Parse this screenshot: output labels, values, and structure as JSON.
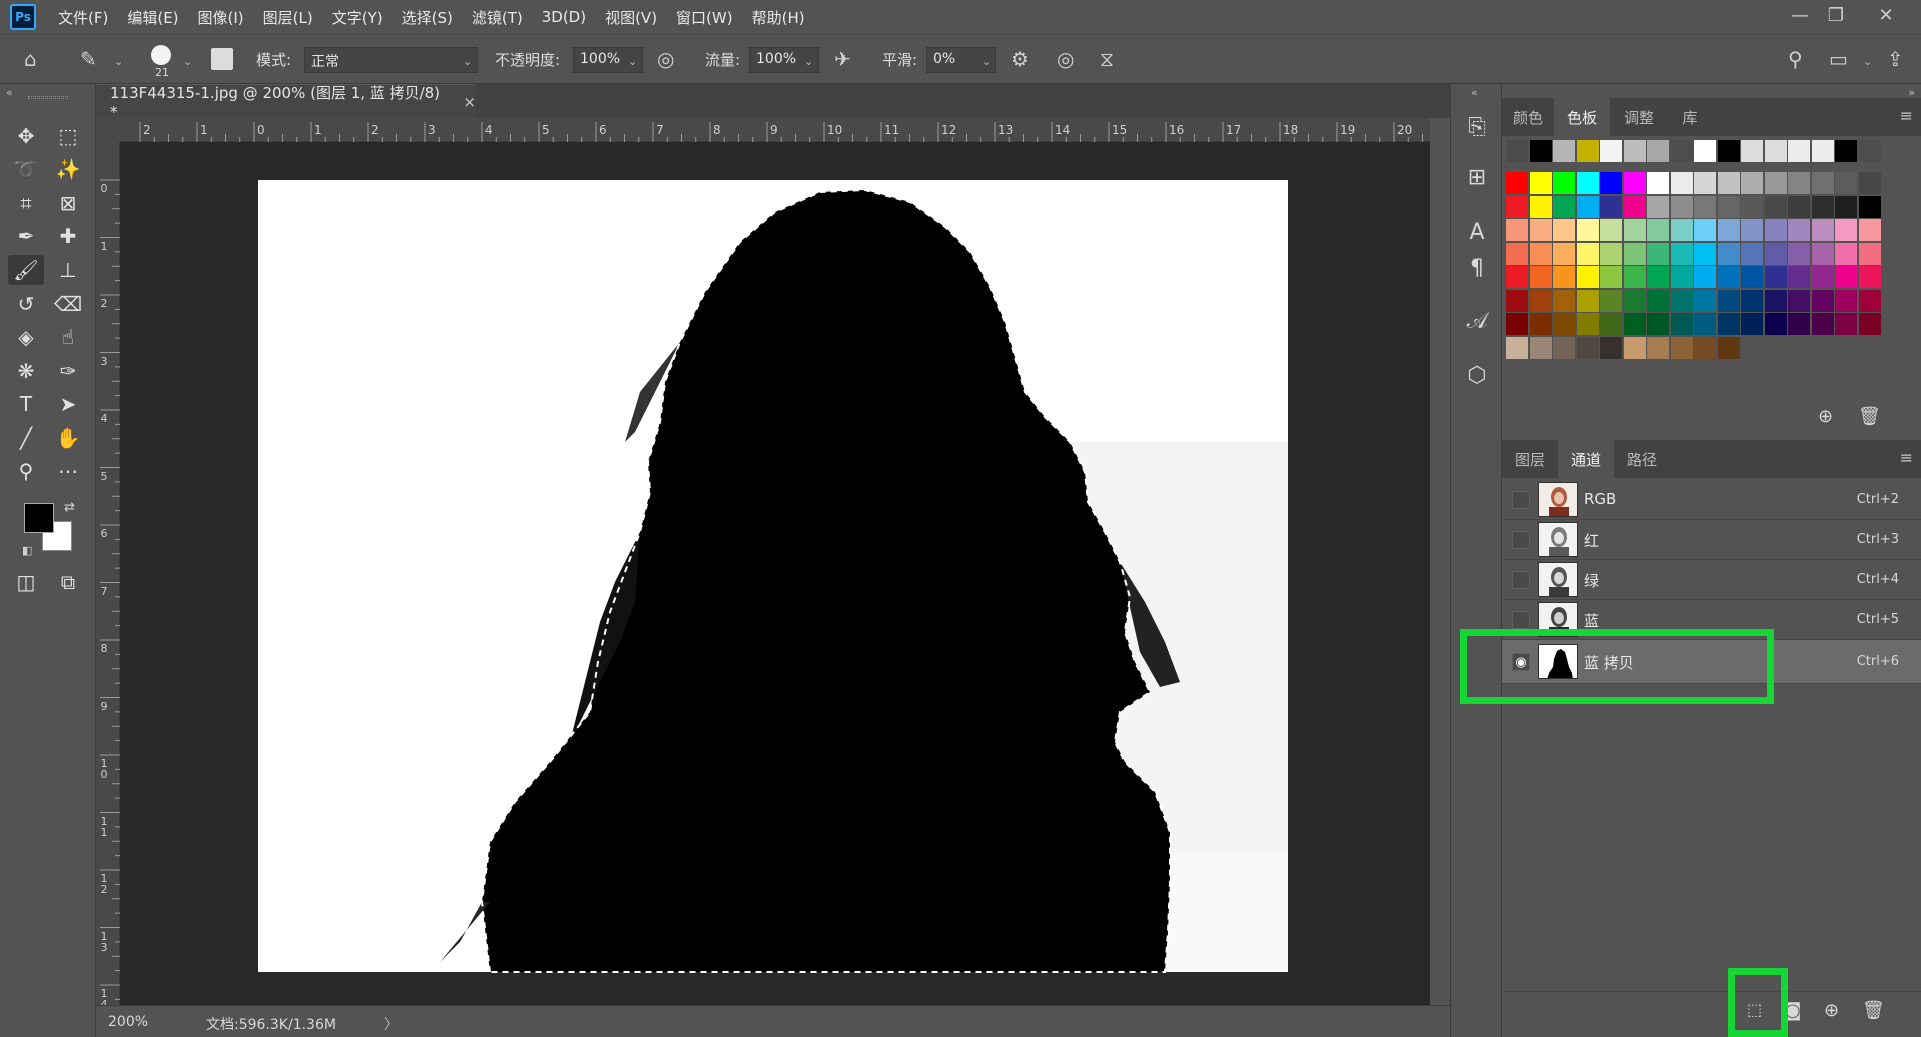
{
  "app": {
    "logo": "Ps"
  },
  "menu": [
    "文件(F)",
    "编辑(E)",
    "图像(I)",
    "图层(L)",
    "文字(Y)",
    "选择(S)",
    "滤镜(T)",
    "3D(D)",
    "视图(V)",
    "窗口(W)",
    "帮助(H)"
  ],
  "options": {
    "brush_size": "21",
    "mode_label": "模式:",
    "mode_value": "正常",
    "opacity_label": "不透明度:",
    "opacity_value": "100%",
    "flow_label": "流量:",
    "flow_value": "100%",
    "smooth_label": "平滑:",
    "smooth_value": "0%"
  },
  "document": {
    "tab_title": "113F44315-1.jpg @ 200% (图层 1, 蓝 拷贝/8) *",
    "close_glyph": "×"
  },
  "ruler": {
    "h_ticks": [
      "2",
      "1",
      "0",
      "1",
      "2",
      "3",
      "4",
      "5",
      "6",
      "7",
      "8",
      "9",
      "10",
      "11",
      "12",
      "13",
      "14",
      "15",
      "16",
      "17",
      "18",
      "19",
      "20"
    ],
    "v_ticks": [
      "0",
      "1",
      "2",
      "3",
      "4",
      "5",
      "6",
      "7",
      "8",
      "9",
      "10",
      "11",
      "12",
      "13",
      "14"
    ]
  },
  "status": {
    "zoom": "200%",
    "doc_info": "文档:596.3K/1.36M"
  },
  "swatch_panel": {
    "tabs": [
      "颜色",
      "色板",
      "调整",
      "库"
    ],
    "active_tab": "色板"
  },
  "channels_panel": {
    "tabs": [
      "图层",
      "通道",
      "路径"
    ],
    "active_tab": "通道",
    "channels": [
      {
        "name": "RGB",
        "shortcut": "Ctrl+2",
        "visible": false,
        "thumb": "color"
      },
      {
        "name": "红",
        "shortcut": "Ctrl+3",
        "visible": false,
        "thumb": "gray"
      },
      {
        "name": "绿",
        "shortcut": "Ctrl+4",
        "visible": false,
        "thumb": "gray"
      },
      {
        "name": "蓝",
        "shortcut": "Ctrl+5",
        "visible": false,
        "thumb": "gray"
      },
      {
        "name": "蓝 拷贝",
        "shortcut": "Ctrl+6",
        "visible": true,
        "thumb": "mask",
        "selected": true
      }
    ]
  },
  "colors": {
    "highlight": "#16d636",
    "swatch_rows": [
      [
        "#4b4b4b",
        "#000000",
        "#b5b5b5",
        "#c4b000",
        "#f4f4f4",
        "#bdbdbd",
        "#a8a8a8",
        "#4d4d4d",
        "#ffffff",
        "#000000",
        "#dcdcdc",
        "#dcdcdc",
        "#ececec",
        "#ececec",
        "#000000",
        "#4d4d4d"
      ],
      [
        "#ff0000",
        "#ffff00",
        "#00ff00",
        "#00ffff",
        "#0000ff",
        "#ff00ff",
        "#ffffff",
        "#ebebeb",
        "#d6d6d6",
        "#c2c2c2",
        "#adadad",
        "#999999",
        "#858585",
        "#707070",
        "#5c5c5c",
        "#474747"
      ],
      [
        "#ed1c24",
        "#fff200",
        "#00a651",
        "#00aeef",
        "#2e3192",
        "#ec008c",
        "#a6a6a6",
        "#8c8c8c",
        "#787878",
        "#666666",
        "#595959",
        "#4a4a4a",
        "#3d3d3d",
        "#2e2e2e",
        "#1f1f1f",
        "#000000"
      ],
      [
        "#f7977a",
        "#f9ad81",
        "#fdc68a",
        "#fff79a",
        "#c4df9b",
        "#a3d39c",
        "#82ca9d",
        "#7bcdc8",
        "#6ecff6",
        "#7ea7d8",
        "#8493ca",
        "#8882be",
        "#a187be",
        "#bc8dbf",
        "#f49ac2",
        "#f6989d"
      ],
      [
        "#f26c4f",
        "#f68e55",
        "#fbaf5c",
        "#fff467",
        "#acd372",
        "#7cc576",
        "#3bb878",
        "#1abbb4",
        "#00bff3",
        "#438ccb",
        "#5574b9",
        "#605ca8",
        "#855fa8",
        "#a763a8",
        "#f06ea9",
        "#f26d7d"
      ],
      [
        "#ed1c24",
        "#f26522",
        "#f7941d",
        "#fff200",
        "#8dc63f",
        "#39b54a",
        "#00a651",
        "#00a99d",
        "#00aeef",
        "#0072bc",
        "#0054a6",
        "#2e3192",
        "#662d91",
        "#92278f",
        "#ec008c",
        "#ed145b"
      ],
      [
        "#9e0b0f",
        "#a0410d",
        "#a36209",
        "#aba000",
        "#598527",
        "#1a7b30",
        "#007236",
        "#00746b",
        "#0076a3",
        "#004a80",
        "#003471",
        "#1b1464",
        "#440e62",
        "#630460",
        "#9e005d",
        "#9e0039"
      ],
      [
        "#790000",
        "#7b2e00",
        "#7d4900",
        "#827b00",
        "#406618",
        "#005e20",
        "#005826",
        "#005952",
        "#005b7f",
        "#003663",
        "#002157",
        "#0d004c",
        "#32004b",
        "#4b0049",
        "#7b0046",
        "#7a0026"
      ],
      [
        "#c7b299",
        "#998675",
        "#736357",
        "#534741",
        "#37302d",
        "#c69c6d",
        "#a67c52",
        "#8c6239",
        "#754c24",
        "#603913"
      ]
    ]
  }
}
